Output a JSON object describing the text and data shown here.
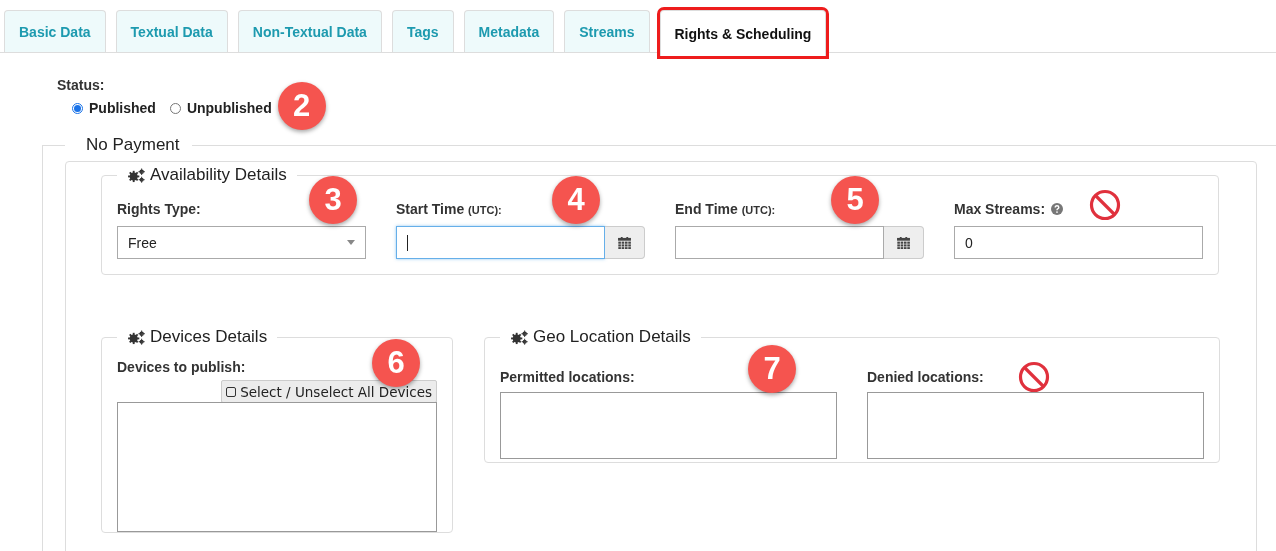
{
  "tabs": [
    {
      "label": "Basic Data",
      "selected": false,
      "highlighted": false
    },
    {
      "label": "Textual Data",
      "selected": false,
      "highlighted": false
    },
    {
      "label": "Non-Textual Data",
      "selected": false,
      "highlighted": false
    },
    {
      "label": "Tags",
      "selected": false,
      "highlighted": false
    },
    {
      "label": "Metadata",
      "selected": false,
      "highlighted": false
    },
    {
      "label": "Streams",
      "selected": false,
      "highlighted": false
    },
    {
      "label": "Rights & Scheduling",
      "selected": true,
      "highlighted": true
    }
  ],
  "status": {
    "label": "Status:",
    "options": [
      {
        "label": "Published",
        "selected": true
      },
      {
        "label": "Unpublished",
        "selected": false
      }
    ],
    "callout": "2"
  },
  "payment_section": {
    "legend": "No Payment",
    "availability": {
      "legend": "Availability Details",
      "fields": [
        {
          "kind": "select",
          "label": "Rights Type:",
          "value": "Free",
          "callout": "3",
          "prohibited": false,
          "help": false
        },
        {
          "kind": "date",
          "label": "Start Time",
          "unit": "(UTC):",
          "focused": true,
          "callout": "4",
          "prohibited": false,
          "help": false
        },
        {
          "kind": "date",
          "label": "End Time",
          "unit": "(UTC):",
          "focused": false,
          "callout": "5",
          "prohibited": false,
          "help": false
        },
        {
          "kind": "number",
          "label": "Max Streams:",
          "value": "0",
          "help": true,
          "prohibited": true
        }
      ]
    },
    "devices": {
      "legend": "Devices Details",
      "label": "Devices to publish:",
      "select_all": {
        "label": "Select / Unselect All Devices",
        "checked": false
      },
      "callout": "6"
    },
    "geo": {
      "legend": "Geo Location Details",
      "callout": "7",
      "fields": [
        {
          "label": "Permitted locations:",
          "prohibited": false
        },
        {
          "label": "Denied locations:",
          "prohibited": true
        }
      ]
    }
  }
}
